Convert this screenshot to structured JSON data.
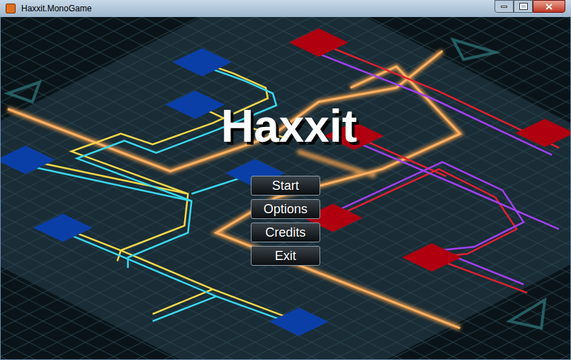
{
  "window": {
    "title": "Haxxit.MonoGame"
  },
  "game": {
    "title": "Haxxit"
  },
  "menu": [
    {
      "label": "Start"
    },
    {
      "label": "Options"
    },
    {
      "label": "Credits"
    },
    {
      "label": "Exit"
    }
  ]
}
